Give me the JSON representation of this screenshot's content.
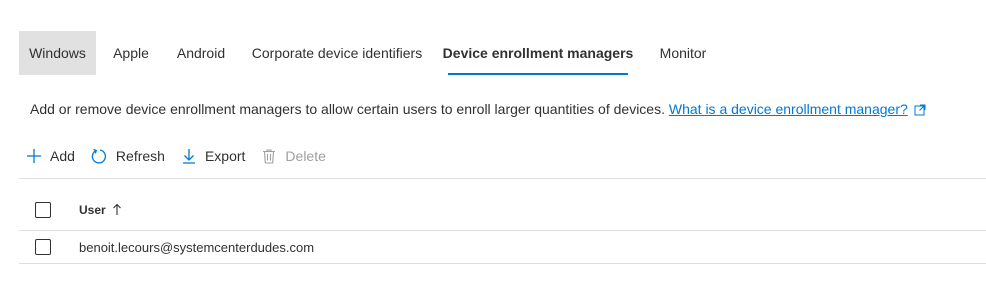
{
  "tabs": [
    {
      "label": "Windows"
    },
    {
      "label": "Apple"
    },
    {
      "label": "Android"
    },
    {
      "label": "Corporate device identifiers"
    },
    {
      "label": "Device enrollment managers"
    },
    {
      "label": "Monitor"
    }
  ],
  "active_tab": "Device enrollment managers",
  "description": {
    "text": "Add or remove device enrollment managers to allow certain users to enroll larger quantities of devices.",
    "link": "What is a device enrollment manager?",
    "link_icon": "external-link-icon"
  },
  "toolbar": {
    "add": "Add",
    "refresh": "Refresh",
    "export": "Export",
    "delete": "Delete"
  },
  "grid": {
    "columns": [
      {
        "label": "User",
        "sort": "ascending"
      }
    ],
    "rows": [
      {
        "user": "benoit.lecours@systemcenterdudes.com"
      }
    ]
  },
  "colors": {
    "accent": "#0078d4",
    "selected_tab_bg": "#e1e1e1",
    "disabled": "#a19f9d"
  }
}
